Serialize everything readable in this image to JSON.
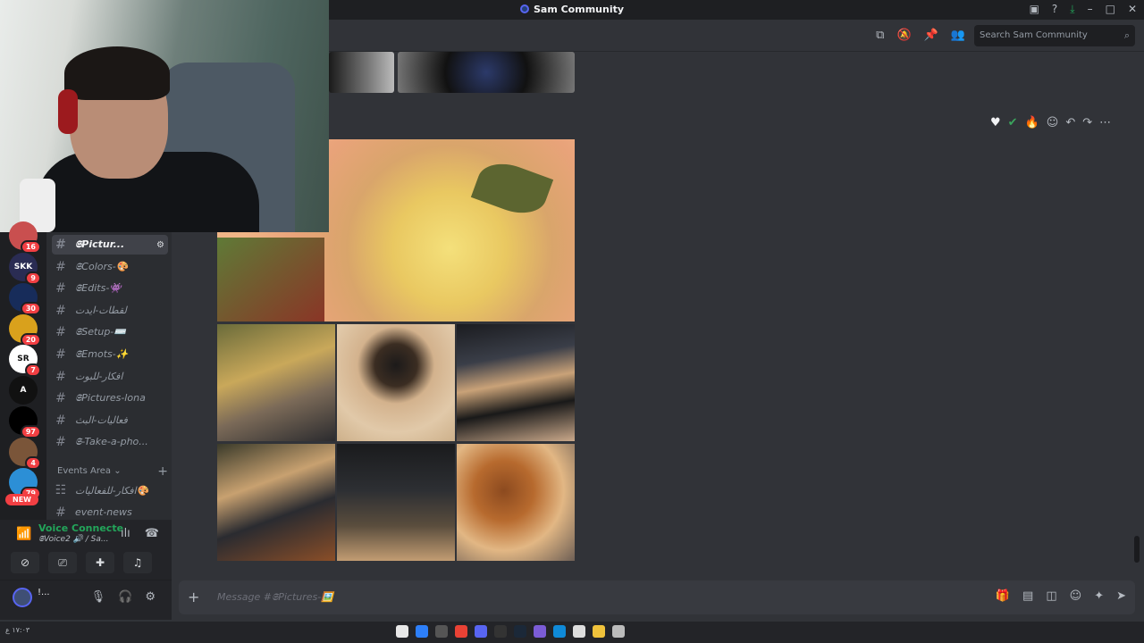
{
  "window": {
    "title": "Sam Community"
  },
  "toolbar": {
    "search_placeholder": "Search Sam Community"
  },
  "servers": [
    {
      "initials": "",
      "badge": "16",
      "color": "#c94f4f"
    },
    {
      "initials": "SKK",
      "badge": "9",
      "color": "#2a2c53"
    },
    {
      "initials": "",
      "badge": "30",
      "color": "#172c5a"
    },
    {
      "initials": "",
      "badge": "20",
      "color": "#d9a11c"
    },
    {
      "initials": "SR",
      "badge": "7",
      "color": "#ffffff"
    },
    {
      "initials": "A",
      "badge": "",
      "color": "#111111"
    },
    {
      "initials": "",
      "badge": "97",
      "color": "#000000"
    },
    {
      "initials": "",
      "badge": "4",
      "color": "#7a5539"
    },
    {
      "initials": "",
      "badge": "79",
      "color": "#2c8fd6"
    }
  ],
  "new_label": "NEW",
  "channels": [
    {
      "name": "𝕾Pictur...",
      "active": true
    },
    {
      "name": "𝕾Colors-🎨",
      "active": false
    },
    {
      "name": "𝕾Edits-👾",
      "active": false
    },
    {
      "name": "لقطات-ايدت",
      "active": false
    },
    {
      "name": "𝕾Setup-⌨️",
      "active": false
    },
    {
      "name": "𝕾Emots-✨",
      "active": false
    },
    {
      "name": "افكار-للبوت",
      "active": false
    },
    {
      "name": "𝕾Pictures-lona",
      "active": false
    },
    {
      "name": "فعاليات-البث",
      "active": false
    },
    {
      "name": "𝕾-Take-a-pho...",
      "active": false
    }
  ],
  "events_category": "Events Area",
  "event_channels": [
    {
      "name": "افكار-للفعاليات🎨"
    },
    {
      "name": "event-news"
    }
  ],
  "voice": {
    "status": "Voice Connecte",
    "channel": "𝕾Voice2 🔊 / Sa..."
  },
  "user": {
    "name": "!..."
  },
  "composer": {
    "placeholder": "Message #𝕾Pictures-🖼️"
  },
  "taskbar": {
    "left_text": "ع‎ ١٧:٠٣"
  },
  "colors": {
    "accent": "#5865f2",
    "online": "#23a55a",
    "danger": "#f23f43"
  }
}
